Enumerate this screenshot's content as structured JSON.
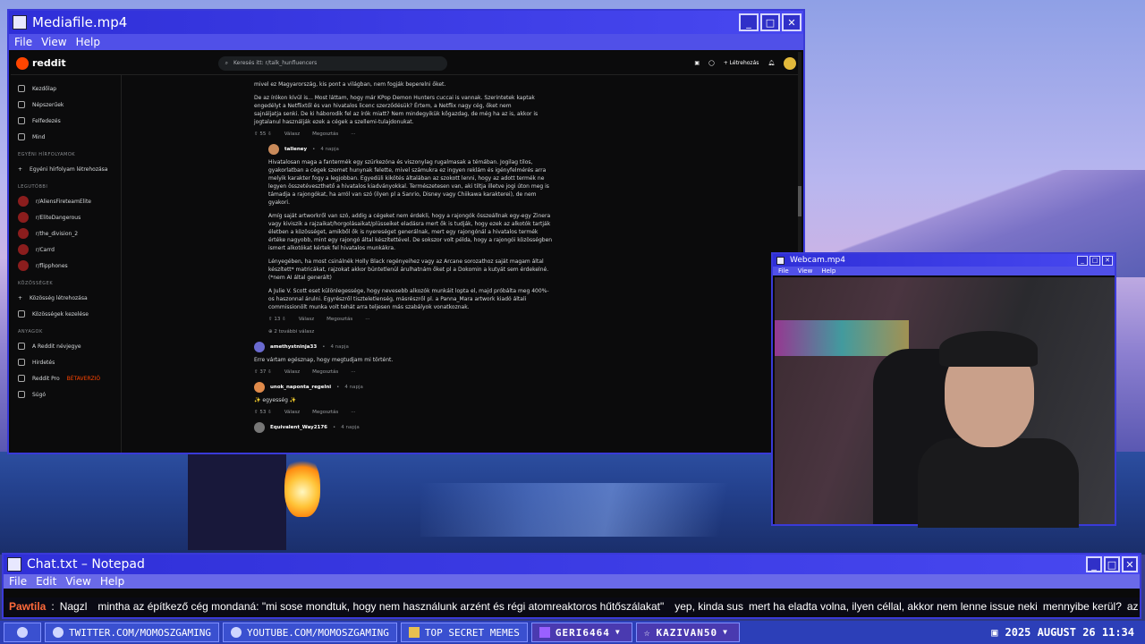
{
  "media_window": {
    "title": "Mediafile.mp4",
    "menu": [
      "File",
      "View",
      "Help"
    ]
  },
  "reddit": {
    "logo": "reddit",
    "search": "Keresés itt: r/talk_hunfluencers",
    "create": "Létrehozás",
    "sidebar": {
      "nav": [
        "Kezdőlap",
        "Népszerűek",
        "Felfedezés",
        "Mind"
      ],
      "custom_section": "EGYÉNI HÍRFOLYAMOK",
      "custom_item": "Egyéni hírfolyam létrehozása",
      "recent_section": "LEGUTÓBBI",
      "recent": [
        "r/AliensFireteamElite",
        "r/EliteDangerous",
        "r/the_division_2",
        "r/Carrd",
        "r/flipphones"
      ],
      "communities_section": "KÖZÖSSÉGEK",
      "communities": [
        "Közösség létrehozása",
        "Közösségek kezelése"
      ],
      "resources_section": "ANYAGOK",
      "resources": [
        "A Reddit névjegye",
        "Hirdetés",
        "Reddit Pro",
        "Súgó"
      ],
      "pro_badge": "BÉTAVERZIÓ"
    },
    "post": {
      "para0": "mivel ez Magyarország, kis pont a világban, nem fogják beperelni őket.",
      "para1": "De az írókon kívül is... Most láttam, hogy már KPop Demon Hunters cuccai is vannak. Szerintetek kaptak engedélyt a Netflixtől és van hivatalos licenc szerződésük? Értem, a Netflix nagy cég, őket nem sajnáljatja senki. De ki háborodik fel az írók miatt? Nem mindegyikük kőgazdag, de még ha az is, akkor is jogtalanul használják ezek a cégek a szellemi-tulajdonukat.",
      "actions1": {
        "votes": "55",
        "reply": "Válasz",
        "share": "Megosztás"
      },
      "reply_user": "talleney",
      "reply_time": "4 napja",
      "reply_p1": "Hivatalosan maga a fantermék egy szürkezóna és viszonylag rugalmasak a témában. Jogilag tilos, gyakorlatban a cégek szemet hunynak felette, mivel számukra ez ingyen reklám és igényfelmérés arra melyik karakter fogy a legjobban. Egyedüli kikötés általában az szokott lenni, hogy az adott termék ne legyen összetéveszthető a hivatalos kiadványokkal. Természetesen van, aki tiltja illetve jogi úton meg is támadja a rajongókat, ha arról van szó (ilyen pl a Sanrio, Disney vagy Chiikawa karakterei), de nem gyakori.",
      "reply_p2": "Amíg saját artworkről van szó, addig a cégeket nem érdekli, hogy a rajongók összeállnak egy-egy Zinera vagy kiviszik a rajzaikat/horgolásaikat/plüsseiket eladásra mert ők is tudják, hogy ezek az alkotók tartják életben a közösséget, amikből ők is nyereséget generálnak, mert egy rajongónál a hivatalos termék értéke nagyobb, mint egy rajongó által készítettével. De sokszor volt példa, hogy a rajongói közösségben ismert alkotókat kértek fel hivatalos munkákra.",
      "reply_p3": "Lényegében, ha most csinálnék Holly Black regényeihez vagy az Arcane sorozathoz saját magam által készített* matricákat, rajzokat akkor büntetlenül árulhatnám őket pl a Dokomin a kutyát sem érdekelné. (*nem AI által generált)",
      "reply_p4": "A Julie V. Scott eset különlegessége, hogy nevesebb alkozók munkáit lopta el, majd próbálta meg 400%-os haszonnal árulni. Egyrészről tiszteletlenség, másrészről pl. a Panna_Mara artwork kiadó általi commissionölt munka volt tehát arra teljesen más szabályok vonatkoznak.",
      "actions2": {
        "votes": "13",
        "reply": "Válasz",
        "share": "Megosztás"
      },
      "more_replies": "2 további válasz",
      "c2_user": "amethystninja33",
      "c2_time": "4 napja",
      "c2_text": "Erre vártam egésznap, hogy megtudjam mi történt.",
      "actions3": {
        "votes": "37",
        "reply": "Válasz",
        "share": "Megosztás"
      },
      "c3_user": "unok_naponta_regelni",
      "c3_time": "4 napja",
      "c3_text": "✨ egyesség ✨",
      "actions4": {
        "votes": "53",
        "reply": "Válasz",
        "share": "Megosztás"
      },
      "c4_user": "Equivalent_Way2176",
      "c4_time": "4 napja"
    }
  },
  "webcam": {
    "title": "Webcam.mp4",
    "menu": [
      "File",
      "View",
      "Help"
    ]
  },
  "notepad": {
    "title": "Chat.txt – Notepad",
    "menu": [
      "File",
      "Edit",
      "View",
      "Help"
    ],
    "chat_user": "Pawtila",
    "chat_sep": ":",
    "chat_1": "Nagzl",
    "chat_2": "mintha az építkező cég mondaná: \"mi sose mondtuk, hogy nem használunk arzént és régi atomreaktoros hűtőszálakat\"",
    "chat_3": "yep, kinda sus",
    "chat_4": "mert ha eladta volna, ilyen céllal, akkor nem lenne issue neki",
    "chat_5": "mennyibe kerül?",
    "chat_6": "az komoly"
  },
  "taskbar": {
    "items": [
      "TWITTER.COM/MOMOSZGAMING",
      "YOUTUBE.COM/MOMOSZGAMING",
      "TOP SECRET MEMES"
    ],
    "user1": "GERI6464",
    "user2": "KAZIVAN50",
    "datetime": "2025 AUGUST 26 11:34"
  }
}
